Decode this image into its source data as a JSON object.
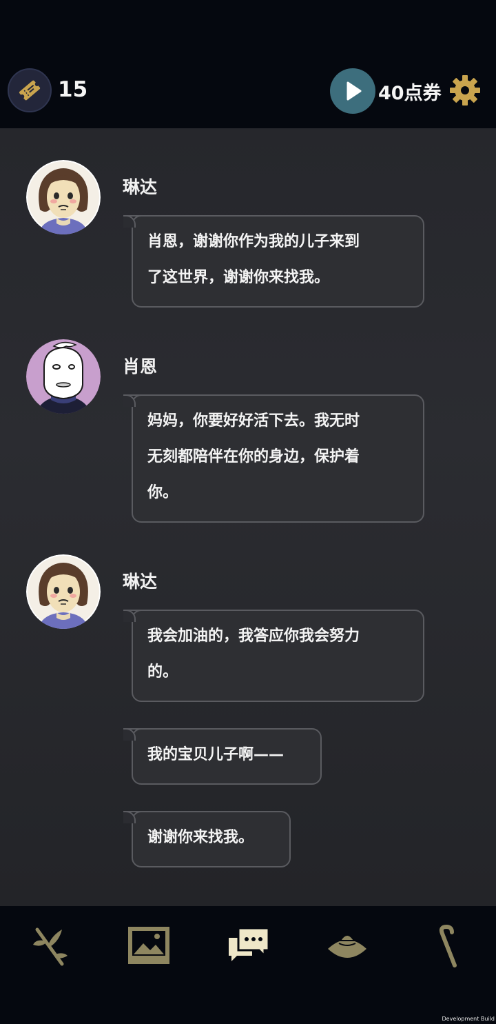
{
  "header": {
    "ticket_count": "15",
    "points_label": "40点券"
  },
  "messages": [
    {
      "speaker": "琳达",
      "lines": [
        "肖恩，谢谢你作为我的儿子来到",
        "了这世界，谢谢你来找我。"
      ]
    },
    {
      "speaker": "肖恩",
      "lines": [
        "妈妈，你要好好活下去。我无时",
        "无刻都陪伴在你的身边，保护着",
        "你。"
      ]
    },
    {
      "speaker": "琳达",
      "lines": [
        "我会加油的，我答应你我会努力",
        "的。"
      ]
    },
    {
      "speaker": "",
      "lines": [
        "我的宝贝儿子啊——"
      ]
    },
    {
      "speaker": "",
      "lines": [
        "谢谢你来找我。"
      ]
    }
  ],
  "bottom_nav": [
    "branch-icon",
    "gallery-icon",
    "chat-icon",
    "hat-icon",
    "cane-icon"
  ],
  "footer": {
    "build_label": "Development Build"
  },
  "colors": {
    "background": "#05080f",
    "chat_bg": "#2a2b30",
    "accent_gold": "#c9a44e",
    "play_button": "#3d6e7d"
  }
}
